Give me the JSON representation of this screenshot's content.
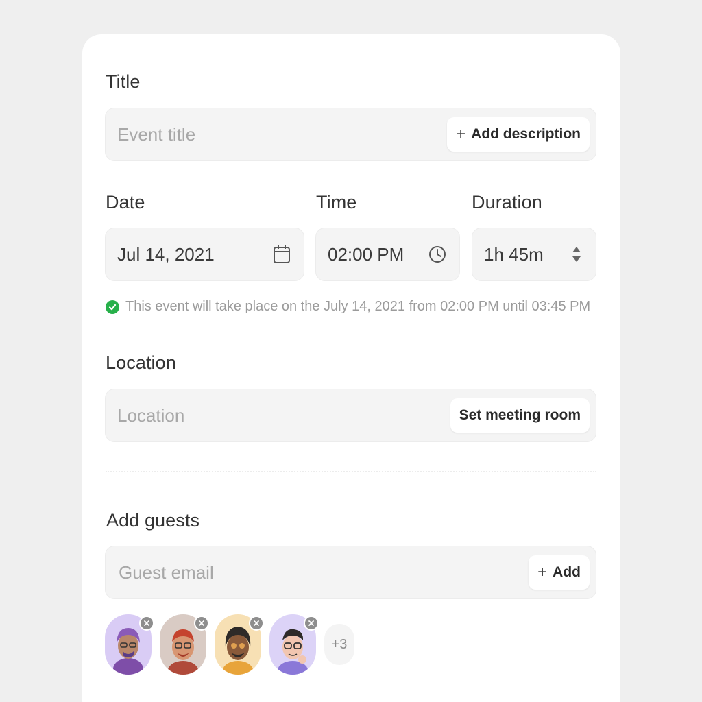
{
  "title_section": {
    "label": "Title",
    "placeholder": "Event title",
    "add_description_label": "Add description"
  },
  "date_section": {
    "label": "Date",
    "value": "Jul 14, 2021",
    "icon": "calendar-icon"
  },
  "time_section": {
    "label": "Time",
    "value": "02:00 PM",
    "icon": "clock-icon"
  },
  "duration_section": {
    "label": "Duration",
    "value": "1h 45m",
    "icon": "stepper-icon"
  },
  "schedule_hint": "This event will take place on the July 14, 2021 from 02:00 PM until 03:45 PM",
  "location_section": {
    "label": "Location",
    "placeholder": "Location",
    "set_room_label": "Set meeting room"
  },
  "guests_section": {
    "label": "Add guests",
    "placeholder": "Guest email",
    "add_label": "Add",
    "guests": [
      {
        "avatar_color": "#d9ccf5",
        "name": "guest-1"
      },
      {
        "avatar_color": "#d9cbc4",
        "name": "guest-2"
      },
      {
        "avatar_color": "#f7e0b4",
        "name": "guest-3"
      },
      {
        "avatar_color": "#dcd3f7",
        "name": "guest-4"
      }
    ],
    "more_count": "+3"
  },
  "colors": {
    "success": "#27b04a",
    "field_bg": "#f4f4f4",
    "page_bg": "#efefef"
  }
}
